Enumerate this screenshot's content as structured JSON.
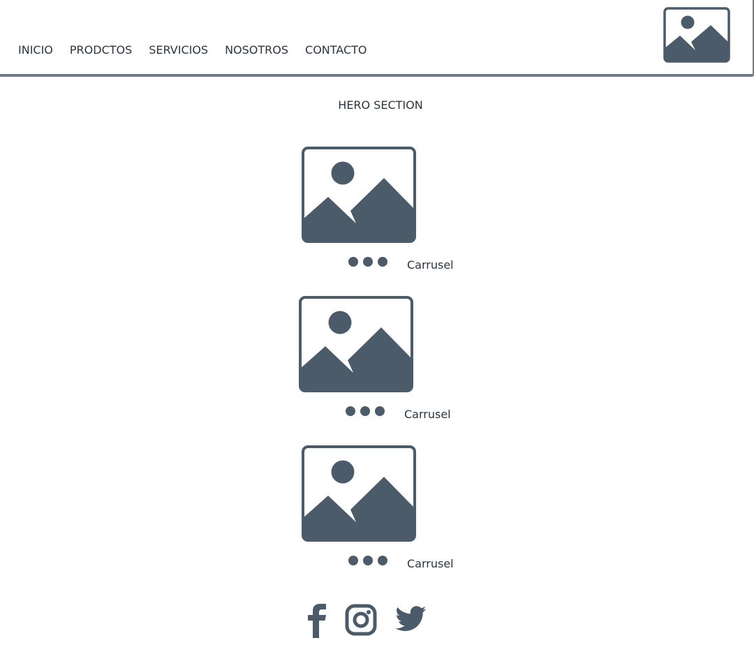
{
  "nav": {
    "items": [
      {
        "label": "INICIO"
      },
      {
        "label": "PRODCTOS"
      },
      {
        "label": "SERVICIOS"
      },
      {
        "label": "NOSOTROS"
      },
      {
        "label": "CONTACTO"
      }
    ],
    "logo_icon": "image-placeholder-icon"
  },
  "hero": {
    "title": "HERO SECTION"
  },
  "carousels": [
    {
      "label": "Carrusel",
      "image_icon": "image-placeholder-icon",
      "dots": 3
    },
    {
      "label": "Carrusel",
      "image_icon": "image-placeholder-icon",
      "dots": 3
    },
    {
      "label": "Carrusel",
      "image_icon": "image-placeholder-icon",
      "dots": 3
    }
  ],
  "social": {
    "icons": [
      "facebook-icon",
      "instagram-icon",
      "twitter-icon"
    ]
  },
  "colors": {
    "icon_fill": "#4b5b6a",
    "text": "#2b3540",
    "nav_border": "#6f7c88"
  }
}
